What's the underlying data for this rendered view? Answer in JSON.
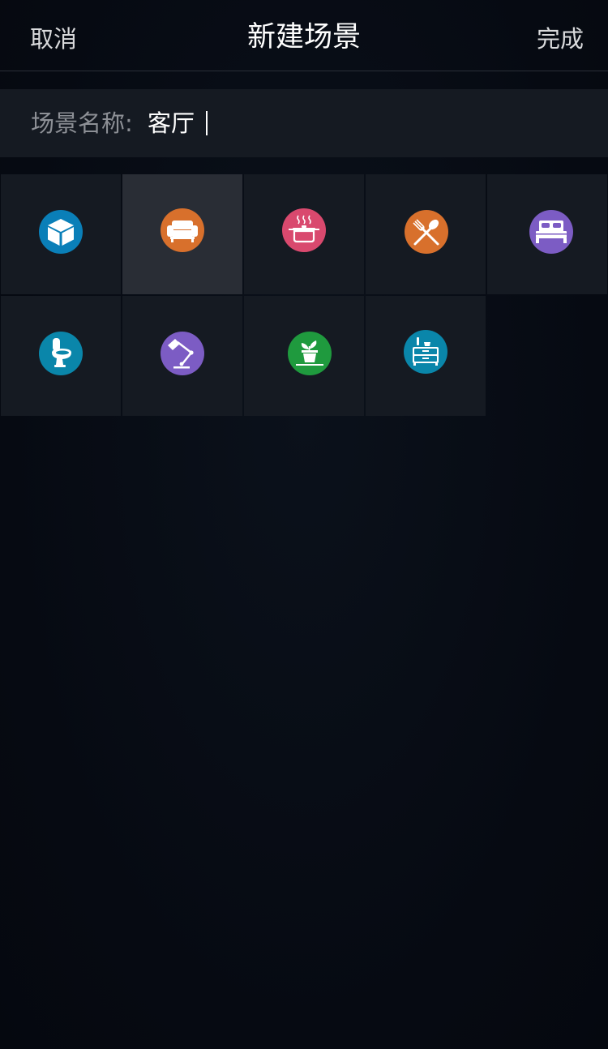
{
  "navbar": {
    "cancel_label": "取消",
    "title": "新建场景",
    "done_label": "完成"
  },
  "scene_name": {
    "label": "场景名称:",
    "value": "客厅"
  },
  "scene_icons": [
    {
      "icon": "box-icon",
      "color": "#0a7fb8",
      "selected": false
    },
    {
      "icon": "sofa-icon",
      "color": "#d8702c",
      "selected": true
    },
    {
      "icon": "cooking-pot-icon",
      "color": "#d9496e",
      "selected": false
    },
    {
      "icon": "fork-spoon-icon",
      "color": "#d8702c",
      "selected": false
    },
    {
      "icon": "bed-icon",
      "color": "#7c5cc4",
      "selected": false
    },
    {
      "icon": "toilet-icon",
      "color": "#0a86aa",
      "selected": false
    },
    {
      "icon": "desk-lamp-icon",
      "color": "#7c5cc4",
      "selected": false
    },
    {
      "icon": "potted-plant-icon",
      "color": "#1f9a3e",
      "selected": false
    },
    {
      "icon": "nightstand-icon",
      "color": "#0a86aa",
      "selected": false
    }
  ]
}
